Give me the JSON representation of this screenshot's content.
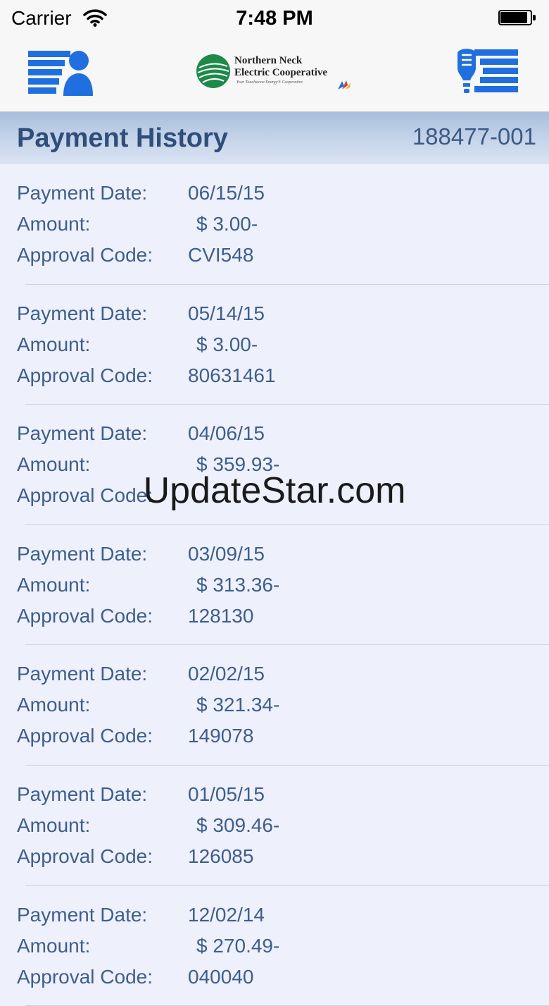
{
  "status_bar": {
    "carrier": "Carrier",
    "time": "7:48 PM"
  },
  "nav": {
    "logo": {
      "line1": "Northern Neck",
      "line2": "Electric Cooperative",
      "tagline": "Your Touchstone Energy® Cooperative"
    },
    "left_icon": "account-menu-icon",
    "right_icon": "bulb-menu-icon"
  },
  "header": {
    "title": "Payment History",
    "account_number": "188477-001"
  },
  "labels": {
    "date": "Payment Date:",
    "amount": "Amount:",
    "approval": "Approval Code:"
  },
  "payments": [
    {
      "date": "06/15/15",
      "amount": "$ 3.00-",
      "approval": "CVI548"
    },
    {
      "date": "05/14/15",
      "amount": "$ 3.00-",
      "approval": "80631461"
    },
    {
      "date": "04/06/15",
      "amount": "$ 359.93-",
      "approval": ""
    },
    {
      "date": "03/09/15",
      "amount": "$ 313.36-",
      "approval": "128130"
    },
    {
      "date": "02/02/15",
      "amount": "$ 321.34-",
      "approval": "149078"
    },
    {
      "date": "01/05/15",
      "amount": "$ 309.46-",
      "approval": "126085"
    },
    {
      "date": "12/02/14",
      "amount": "$ 270.49-",
      "approval": "040040"
    }
  ],
  "watermark": "UpdateStar.com",
  "colors": {
    "label_text": "#3d5f8f",
    "title_text": "#2f4f7a",
    "icon_blue": "#1f6fe0",
    "background": "#eef0fb"
  }
}
